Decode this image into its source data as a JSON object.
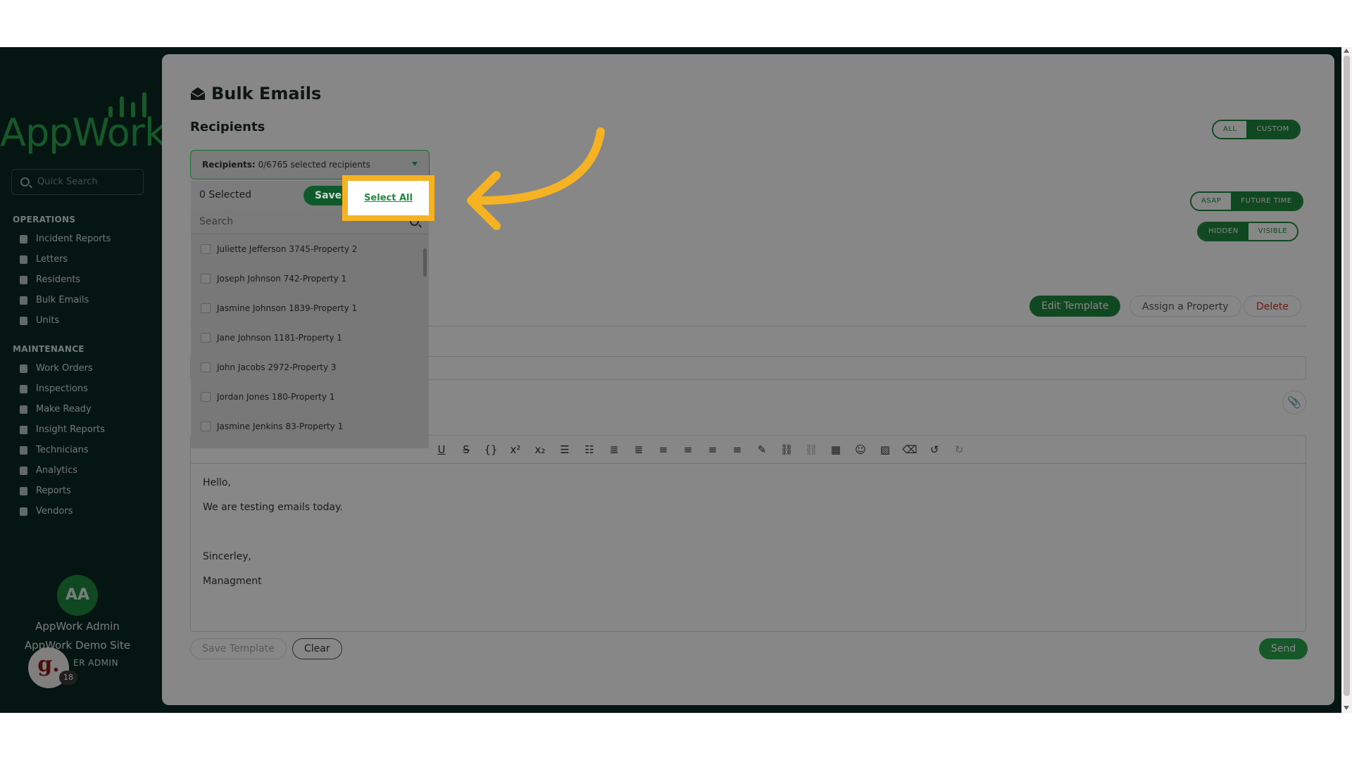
{
  "app": {
    "logo_text": "AppWork"
  },
  "sidebar": {
    "quick_search_placeholder": "Quick Search",
    "sections": [
      {
        "title": "OPERATIONS",
        "items": [
          "Incident Reports",
          "Letters",
          "Residents",
          "Bulk Emails",
          "Units"
        ]
      },
      {
        "title": "MAINTENANCE",
        "items": [
          "Work Orders",
          "Inspections",
          "Make Ready",
          "Insight Reports",
          "Technicians",
          "Analytics",
          "Reports",
          "Vendors"
        ]
      }
    ],
    "user": {
      "initials": "AA",
      "name": "AppWork Admin",
      "site": "AppWork Demo Site",
      "role": "ER ADMIN"
    },
    "badge": {
      "letter": "g.",
      "count": "18"
    }
  },
  "main": {
    "page_title": "Bulk Emails",
    "recipients_heading": "Recipients",
    "toggle_all_custom": {
      "left": "ALL",
      "right": "CUSTOM",
      "active": "CUSTOM"
    },
    "toggle_asap_future": {
      "left": "ASAP",
      "right": "FUTURE TIME",
      "active": "FUTURE TIME"
    },
    "toggle_hidden_visible": {
      "left": "HIDDEN",
      "right": "VISIBLE",
      "active": "HIDDEN"
    },
    "template_actions": {
      "edit": "Edit Template",
      "assign": "Assign a Property",
      "delete": "Delete"
    },
    "editor_lines": [
      "Hello,",
      "We are testing emails today.",
      "",
      "Sincerley,",
      "Managment"
    ],
    "bottom": {
      "save_template": "Save Template",
      "clear": "Clear",
      "send": "Send"
    }
  },
  "dropdown": {
    "label_bold": "Recipients:",
    "label_value": "0/6765 selected recipients",
    "selected_count": "0 Selected",
    "save_label": "Save",
    "select_all_label": "Select All",
    "search_placeholder": "Search",
    "items": [
      "Juliette Jefferson 3745-Property 2",
      "Joseph Johnson 742-Property 1",
      "Jasmine Johnson 1839-Property 1",
      "Jane Johnson 1181-Property 1",
      "John Jacobs 2972-Property 3",
      "Jordan Jones 180-Property 1",
      "Jasmine Jenkins 83-Property 1"
    ]
  },
  "colors": {
    "brand": "#1f8a3f",
    "highlight": "#f5b324",
    "sidebar_bg": "#0b2a22"
  }
}
